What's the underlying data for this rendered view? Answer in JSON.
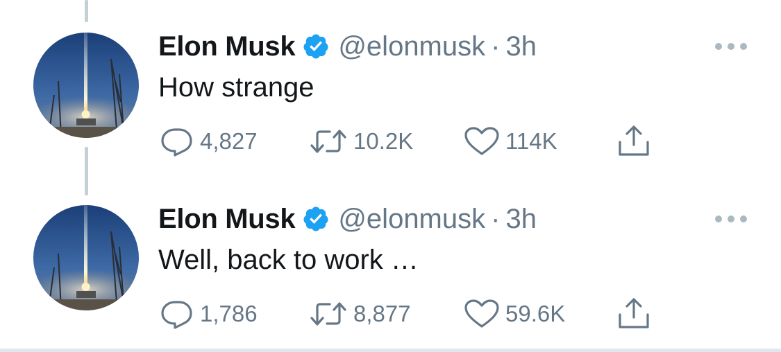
{
  "tweets": [
    {
      "name": "Elon Musk",
      "handle": "@elonmusk",
      "separator": "·",
      "time": "3h",
      "text": "How strange",
      "replies": "4,827",
      "retweets": "10.2K",
      "likes": "114K"
    },
    {
      "name": "Elon Musk",
      "handle": "@elonmusk",
      "separator": "·",
      "time": "3h",
      "text": "Well, back to work …",
      "replies": "1,786",
      "retweets": "8,877",
      "likes": "59.6K"
    }
  ],
  "icons": {
    "verified": "verified-badge-icon",
    "more": "more-dots-icon",
    "reply": "reply-icon",
    "retweet": "retweet-icon",
    "like": "heart-icon",
    "share": "share-icon"
  },
  "colors": {
    "text": "#14171a",
    "secondary": "#657786",
    "verified": "#1da1f2",
    "thread_line": "#c4cfd6"
  }
}
